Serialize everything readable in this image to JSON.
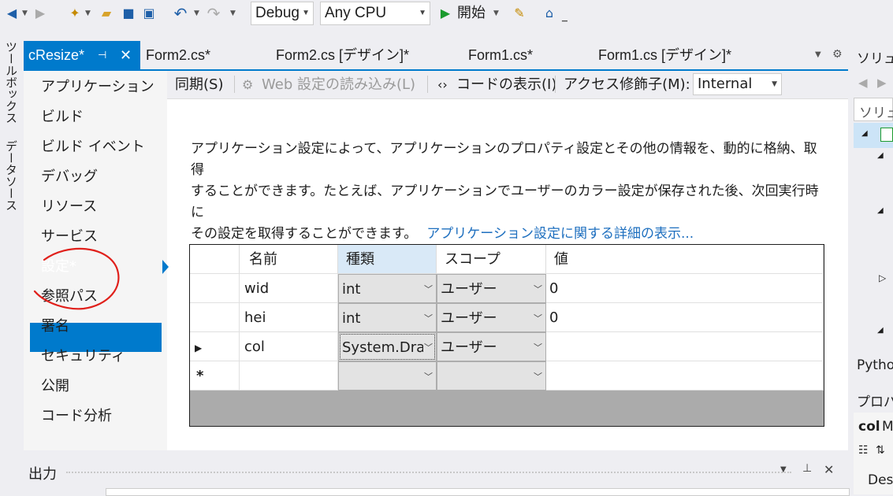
{
  "toolbar": {
    "config": "Debug",
    "platform": "Any CPU",
    "start_label": "開始"
  },
  "left_strip": {
    "toolbox": "ツールボックス",
    "datasources": "データソース"
  },
  "tabs": [
    {
      "label": "cResize*"
    },
    {
      "label": "Form2.cs*"
    },
    {
      "label": "Form2.cs [デザイン]*"
    },
    {
      "label": "Form1.cs*"
    },
    {
      "label": "Form1.cs [デザイン]*"
    }
  ],
  "nav": [
    {
      "label": "アプリケーション"
    },
    {
      "label": "ビルド"
    },
    {
      "label": "ビルド イベント"
    },
    {
      "label": "デバッグ"
    },
    {
      "label": "リソース"
    },
    {
      "label": "サービス"
    },
    {
      "label": "設定*"
    },
    {
      "label": "参照パス"
    },
    {
      "label": "署名"
    },
    {
      "label": "セキュリティ"
    },
    {
      "label": "公開"
    },
    {
      "label": "コード分析"
    }
  ],
  "settings_toolbar": {
    "sync": "同期(S)",
    "load_web": "Web 設定の読み込み(L)",
    "view_code": "コードの表示(I)",
    "access_label": "アクセス修飾子(M):",
    "access_value": "Internal"
  },
  "description": {
    "line1": "アプリケーション設定によって、アプリケーションのプロパティ設定とその他の情報を、動的に格納、取得",
    "line2": "することができます。たとえば、アプリケーションでユーザーのカラー設定が保存された後、次回実行時に",
    "line3": "その設定を取得することができます。",
    "link": "アプリケーション設定に関する詳細の表示..."
  },
  "grid": {
    "headers": [
      "名前",
      "種類",
      "スコープ",
      "値"
    ],
    "rows": [
      {
        "name": "wid",
        "type": "int",
        "scope": "ユーザー",
        "value": "0"
      },
      {
        "name": "hei",
        "type": "int",
        "scope": "ユーザー",
        "value": "0"
      },
      {
        "name": "col",
        "type": "System.Drawing.Color",
        "scope": "ユーザー",
        "value": ""
      }
    ],
    "new_row_marker": "*"
  },
  "output": {
    "title": "出力"
  },
  "right_panel": {
    "solution_title": "ソリュー",
    "search_placeholder": "ソリュー",
    "python_tab": "Pytho",
    "properties_title": "プロパ",
    "selected_object": "col",
    "selected_object_type": "M",
    "desc_label": "Des"
  },
  "colors": {
    "accent": "#007acc",
    "link": "#1e6fbf",
    "annotation": "#e0201b"
  }
}
